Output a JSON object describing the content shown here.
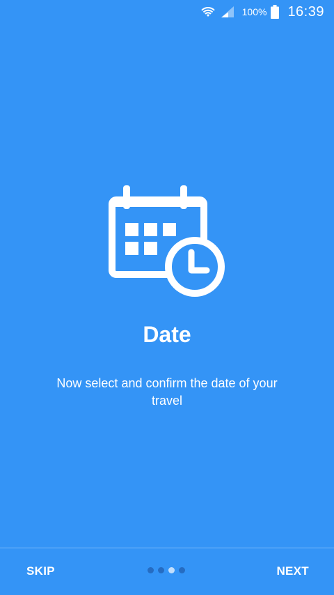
{
  "status_bar": {
    "battery_percent": "100%",
    "time": "16:39",
    "icons": [
      "wifi-icon",
      "signal-icon",
      "battery-icon"
    ]
  },
  "onboarding": {
    "icon": "calendar-clock-icon",
    "title": "Date",
    "description": "Now select and confirm the date of your travel"
  },
  "footer": {
    "skip_label": "SKIP",
    "next_label": "NEXT",
    "page_count": 4,
    "current_page": 3
  },
  "colors": {
    "background": "#3494f6",
    "foreground": "#ffffff"
  }
}
